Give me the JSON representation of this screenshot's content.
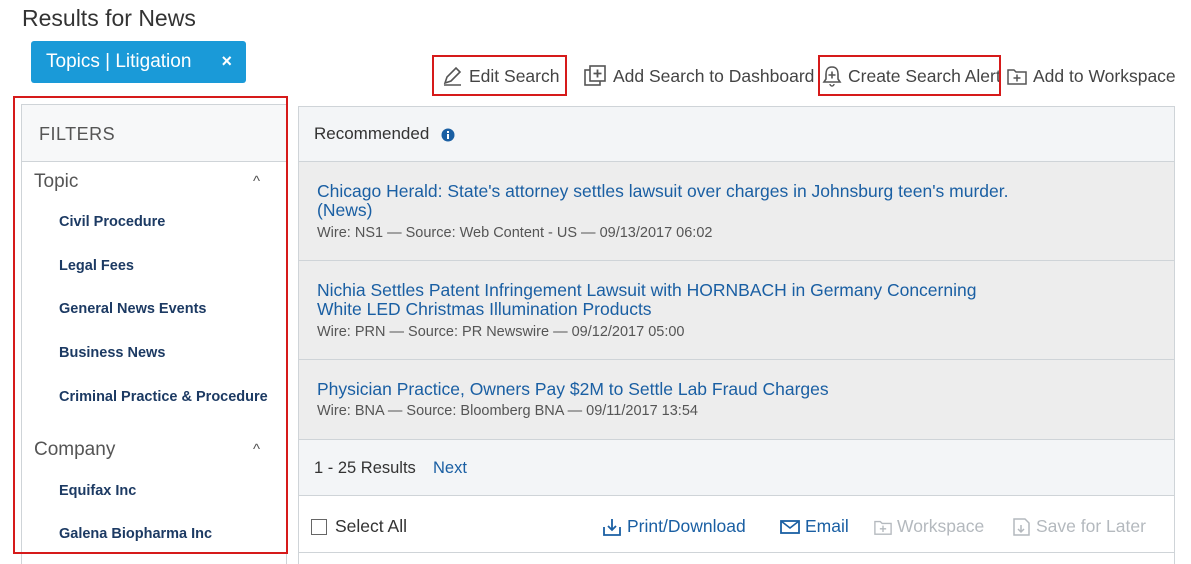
{
  "page": {
    "title": "Results for News"
  },
  "chip": {
    "label": "Topics | Litigation",
    "close": "×"
  },
  "toolbar": {
    "edit_search": "Edit Search",
    "add_dashboard": "Add Search to Dashboard",
    "create_alert": "Create Search Alert",
    "add_workspace": "Add to Workspace"
  },
  "filters": {
    "header": "FILTERS",
    "groups": [
      {
        "label": "Topic",
        "caret": "^",
        "items": [
          "Civil Procedure",
          "Legal Fees",
          "General News Events",
          "Business News",
          "Criminal Practice & Procedure"
        ]
      },
      {
        "label": "Company",
        "caret": "^",
        "items": [
          "Equifax Inc",
          "Galena Biopharma Inc"
        ]
      }
    ]
  },
  "recommended": {
    "label": "Recommended"
  },
  "results": [
    {
      "title": "Chicago Herald: State's attorney settles lawsuit over charges in Johnsburg teen's murder.(News)",
      "meta": "Wire: NS1  —  Source: Web Content - US  —  09/13/2017 06:02"
    },
    {
      "title": "Nichia Settles Patent Infringement Lawsuit with HORNBACH in Germany Concerning White LED Christmas Illumination Products",
      "meta": "Wire: PRN  —  Source: PR Newswire  —  09/12/2017 05:00"
    },
    {
      "title": "Physician Practice, Owners Pay $2M to Settle Lab Fraud Charges",
      "meta": "Wire: BNA  —  Source: Bloomberg BNA  —  09/11/2017 13:54"
    }
  ],
  "pager": {
    "range": "1 - 25 Results",
    "next": "Next"
  },
  "actions": {
    "select_all": "Select All",
    "print": "Print/Download",
    "email": "Email",
    "workspace": "Workspace",
    "save_later": "Save for Later"
  },
  "colors": {
    "accent": "#1a9ad8",
    "link": "#1a5fa3",
    "highlight": "#d61a1a",
    "filter_text": "#1c3a63"
  }
}
